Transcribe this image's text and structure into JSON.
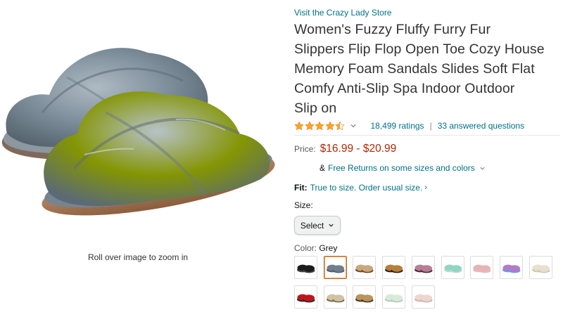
{
  "image": {
    "alt": "Grey fuzzy cross-strap slippers",
    "zoom_hint": "Roll over image to zoom in"
  },
  "store_link": "Visit the Crazy Lady Store",
  "title": "Women's Fuzzy Fluffy Furry Fur Slippers Flip Flop Open Toe Cozy House Memory Foam Sandals Slides Soft Flat Comfy Anti-Slip Spa Indoor Outdoor Slip on",
  "title_lines": [
    "Women's Fuzzy Fluffy Furry Fur",
    "Slippers Flip Flop Open Toe Cozy House",
    "Memory Foam Sandals Slides Soft Flat",
    "Comfy Anti-Slip Spa Indoor Outdoor",
    "Slip on"
  ],
  "rating": {
    "stars": 4.5,
    "ratings_text": "18,499 ratings",
    "separator": "|",
    "answered_text": "33 answered questions"
  },
  "price": {
    "label": "Price:",
    "value": "$16.99 - $20.99"
  },
  "returns": {
    "prefix": "&",
    "text": "Free Returns on some sizes and colors"
  },
  "fit": {
    "label": "Fit:",
    "text": "True to size. Order usual size."
  },
  "size": {
    "label": "Size:",
    "select_value": "Select"
  },
  "color": {
    "label": "Color:",
    "value": "Grey"
  },
  "swatches": [
    {
      "name": "black",
      "fur": "#1c1c1c",
      "sole": "#444444",
      "selected": false
    },
    {
      "name": "grey",
      "fur": "#6f7f8c",
      "sole": "#54606a",
      "selected": true
    },
    {
      "name": "leopard-light",
      "fur": "#c9a77b",
      "sole": "#6a4a2c",
      "selected": false
    },
    {
      "name": "leopard",
      "fur": "#b57f3e",
      "sole": "#2d1d10",
      "selected": false
    },
    {
      "name": "pink-leopard",
      "fur": "#b77e94",
      "sole": "#4d2d3a",
      "selected": false
    },
    {
      "name": "mint",
      "fur": "#8fd6c2",
      "sole": "#cbd8d3",
      "selected": false
    },
    {
      "name": "pink",
      "fur": "#e8b4b3",
      "sole": "#d6c3c1",
      "selected": false
    },
    {
      "name": "rainbow",
      "fur": "#b37ac9",
      "sole": "#6aa0d8",
      "selected": false
    },
    {
      "name": "beige",
      "fur": "#e6e0cf",
      "sole": "#cfc6b3",
      "selected": false
    },
    {
      "name": "red",
      "fur": "#c0141b",
      "sole": "#2b2b2b",
      "selected": false
    },
    {
      "name": "cream-leopard",
      "fur": "#cfc3a4",
      "sole": "#7b6a4a",
      "selected": false
    },
    {
      "name": "tan-leopard",
      "fur": "#b9955c",
      "sole": "#4b3621",
      "selected": false
    },
    {
      "name": "pale-green",
      "fur": "#d8ead9",
      "sole": "#b8cbb9",
      "selected": false
    },
    {
      "name": "light-pink",
      "fur": "#ecd6cf",
      "sole": "#cdb7ae",
      "selected": false
    }
  ],
  "colors": {
    "link": "#007185",
    "price": "#B12704",
    "star": "#FFA41C",
    "selected_border": "#C46B28"
  }
}
